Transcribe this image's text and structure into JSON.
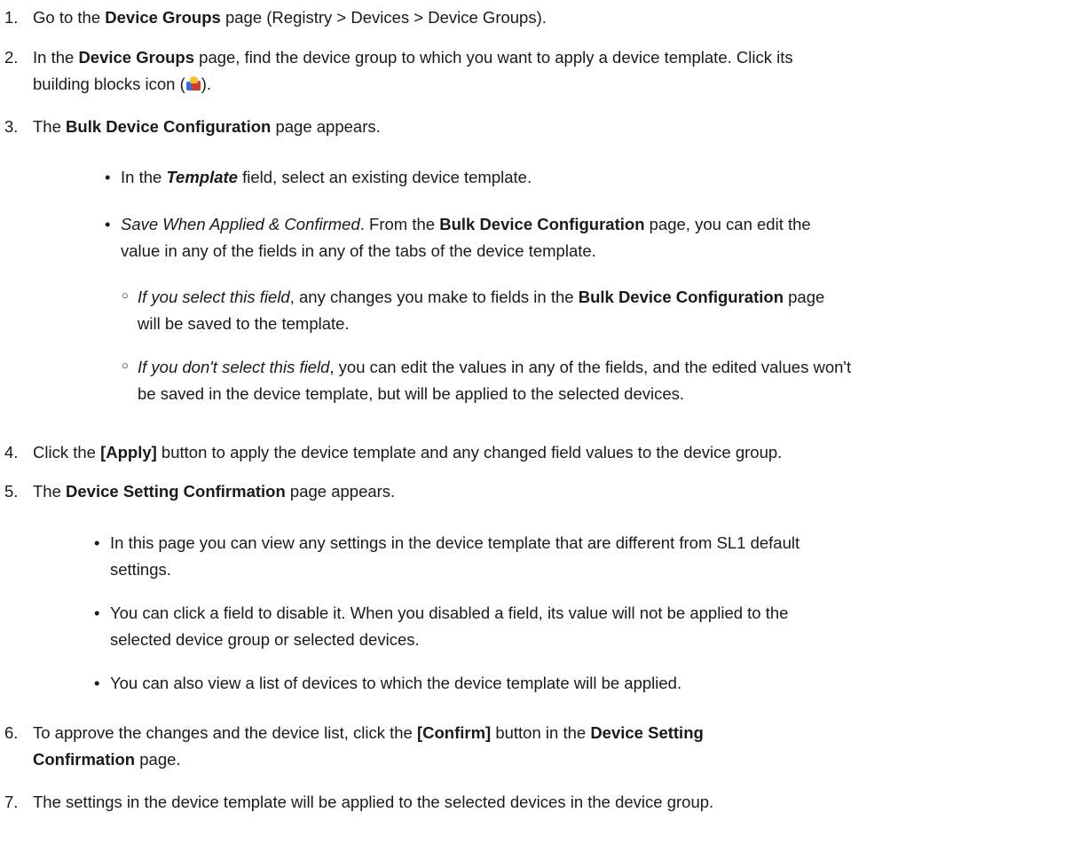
{
  "steps": [
    {
      "num": "1.",
      "pre": "Go to the ",
      "b1": "Device Groups",
      "post": " page (Registry > Devices > Device Groups)."
    },
    {
      "num": "2.",
      "pre": "In the ",
      "b1": "Device Groups",
      "mid": " page, find the device group to which you want to apply a device template. Click its",
      "line2a": "building blocks icon (",
      "line2b": ")."
    },
    {
      "num": "3.",
      "pre": "The ",
      "b1": "Bulk Device Configuration",
      "post": " page appears."
    },
    {
      "num": "4.",
      "pre": "Click the ",
      "b1": "[Apply]",
      "post": " button to apply the device template and any changed field values to the device group."
    },
    {
      "num": "5.",
      "pre": "The ",
      "b1": "Device Setting Confirmation",
      "post": " page appears."
    },
    {
      "num": "6.",
      "pre": "To approve the changes and the device list, click the ",
      "b1": "[Confirm]",
      "mid": " button in the ",
      "b2a": "Device Setting",
      "b2b": "Confirmation",
      "post": " page."
    },
    {
      "num": "7.",
      "text": "The settings in the device template will be applied to the selected devices in the device group."
    }
  ],
  "step3_bullets": {
    "b1_pre": "In the ",
    "b1_field": "Template",
    "b1_post": " field, select an existing device template.",
    "b2_lead": "Save When Applied & Confirmed",
    "b2_mid": ". From the ",
    "b2_bold": "Bulk Device Configuration",
    "b2_line1_end": " page, you can edit the",
    "b2_line2": "value in any of the fields in any of the tabs of the device template.",
    "sub1_lead": "If you select this field",
    "sub1_mid": ", any changes you make to fields in the ",
    "sub1_bold": "Bulk Device Configuration",
    "sub1_end": " page",
    "sub1_line2": "will be saved to the template.",
    "sub2_lead": "If you don't select this field",
    "sub2_line1": ", you can edit the values in any of the fields, and the edited values won't",
    "sub2_line2": "be saved in the device template, but will be applied to the selected devices."
  },
  "step5_bullets": [
    {
      "line1": "In this page you can view any settings in the device template that are different from SL1 default",
      "line2": "settings."
    },
    {
      "line1": "You can click a field to disable it. When you disabled a field, its value will not be applied to the",
      "line2": "selected device group or selected devices."
    },
    {
      "line1": "You can also view a list of devices to which the device template will be applied.",
      "line2": ""
    }
  ],
  "icons": {
    "building_blocks": "building-blocks-icon"
  }
}
